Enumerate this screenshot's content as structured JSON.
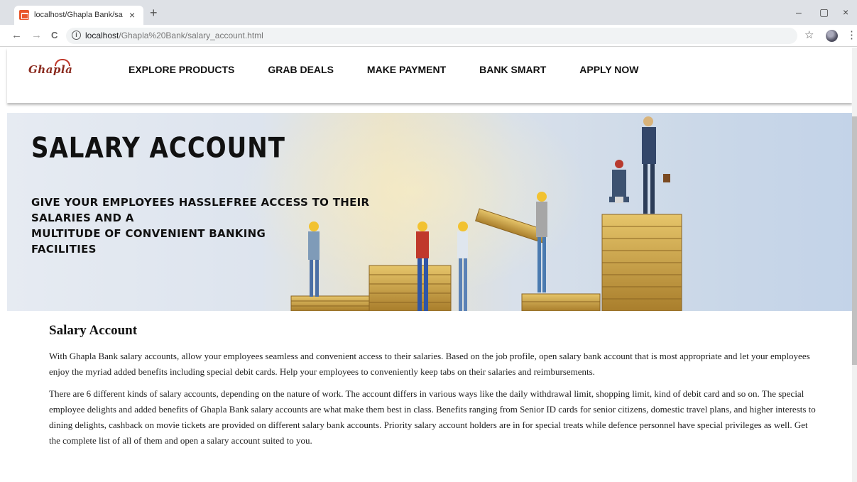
{
  "browser": {
    "tab_title": "localhost/Ghapla Bank/salary_ac",
    "tab_close": "×",
    "new_tab": "+",
    "url_host": "localhost",
    "url_path": "/Ghapla%20Bank/salary_account.html",
    "back_icon": "←",
    "forward_icon": "→",
    "reload_icon": "C",
    "star_icon": "☆",
    "menu_icon": "⋮",
    "minimize": "–",
    "maximize": "▢",
    "close": "×"
  },
  "site": {
    "logo_text": "Ghapla",
    "nav": [
      "EXPLORE PRODUCTS",
      "GRAB DEALS",
      "MAKE PAYMENT",
      "BANK SMART",
      "APPLY NOW"
    ]
  },
  "hero": {
    "title": "SALARY ACCOUNT",
    "subtitle_line1": "GIVE YOUR EMPLOYEES HASSLEFREE ACCESS TO THEIR SALARIES AND A",
    "subtitle_line2": "MULTITUDE OF CONVENIENT BANKING",
    "subtitle_line3": "FACILITIES"
  },
  "content": {
    "title": "Salary Account",
    "paragraph1": "With Ghapla Bank salary accounts, allow your employees seamless and convenient access to their salaries. Based on the job profile, open salary bank account that is most appropriate and let your employees enjoy the myriad added benefits including special debit cards. Help your employees to conveniently keep tabs on their salaries and reimbursements.",
    "paragraph2": "There are 6 different kinds of salary accounts, depending on the nature of work. The account differs in various ways like the daily withdrawal limit, shopping limit, kind of debit card and so on. The special employee delights and added benefits of Ghapla Bank salary accounts are what make them best in class. Benefits ranging from Senior ID cards for senior citizens, domestic travel plans, and higher interests to dining delights, cashback on movie tickets are provided on different salary bank accounts. Priority salary account holders are in for special treats while defence personnel have special privileges as well. Get the complete list of all of them and open a salary account suited to you."
  },
  "colors": {
    "accent": "#8a2a1e",
    "favicon": "#e9572b",
    "coin_gold": "#c9a34a"
  }
}
